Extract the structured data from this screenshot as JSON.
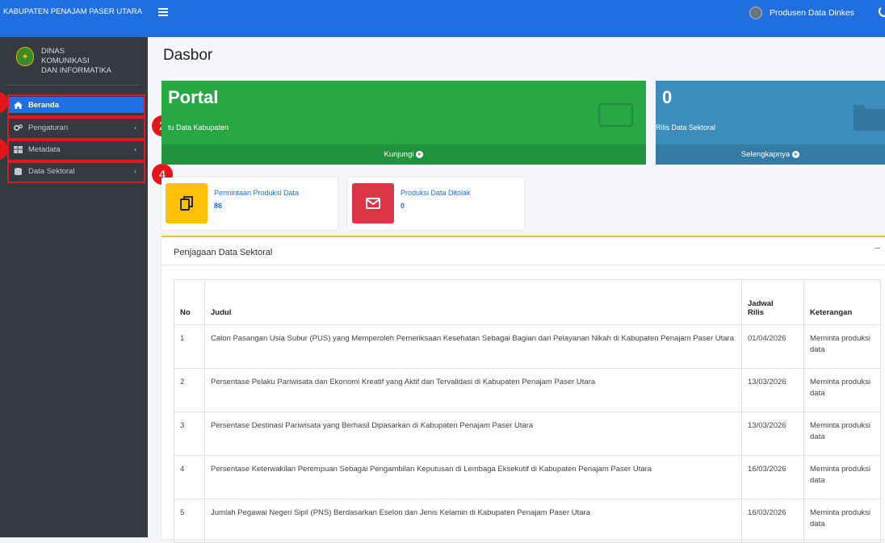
{
  "brand": {
    "title": "KABUPATEN PENAJAM PASER UTARA"
  },
  "navbar": {
    "user_name": "Produsen Data Dinkes"
  },
  "sidebar": {
    "org_name_line1": "DINAS KOMUNIKASI",
    "org_name_line2": "DAN INFORMATIKA",
    "items": [
      {
        "label": "Beranda",
        "icon": "home-icon",
        "active": true
      },
      {
        "label": "Pengaturan",
        "icon": "gears-icon"
      },
      {
        "label": "Metadata",
        "icon": "grid-icon"
      },
      {
        "label": "Data Sektoral",
        "icon": "database-icon"
      }
    ]
  },
  "annotations": {
    "badge2": "2",
    "badge4": "4"
  },
  "page_title": "Dasbor",
  "cards": {
    "portal": {
      "title": "Portal",
      "subtitle": "tu Data Kabupaten",
      "footer": "Kunjungi",
      "color": "#28a745"
    },
    "rilis": {
      "value": "0",
      "subtitle": "Rilis Data Sektoral",
      "footer": "Selengkapnya",
      "color": "#3c8dbc"
    }
  },
  "info_boxes": [
    {
      "label": "Permintaan Produksi Data",
      "value": "86",
      "icon": "copy-icon",
      "color": "#ffc107"
    },
    {
      "label": "Produksi Data Ditolak",
      "value": "0",
      "icon": "envelope-icon",
      "color": "#dc3545"
    }
  ],
  "panel": {
    "title": "Penjagaan Data Sektoral",
    "columns": {
      "no": "No",
      "judul": "Judul",
      "jadwal_1": "Jadwal",
      "jadwal_2": "Rilis",
      "ket": "Keterangan"
    },
    "rows": [
      {
        "no": "1",
        "judul": "Calon Pasangan Usia Subur (PUS) yang Memperoleh Pemeriksaan Kesehatan Sebagai Bagian dari Pelayanan Nikah di Kabupaten Penajam Paser Utara",
        "jadwal": "01/04/2026",
        "ket": "Meminta produksi data"
      },
      {
        "no": "2",
        "judul": "Persentase Pelaku Pariwisata dan Ekonomi Kreatif yang Aktif dan Tervalidasi di Kabupaten Penajam Paser Utara",
        "jadwal": "13/03/2026",
        "ket": "Meminta produksi data"
      },
      {
        "no": "3",
        "judul": "Persentase Destinasi Pariwisata yang Berhasil Dipasarkan di Kabupaten Penajam Paser Utara",
        "jadwal": "13/03/2026",
        "ket": "Meminta produksi data"
      },
      {
        "no": "4",
        "judul": "Persentase Keterwakilan Perempuan Sebagai Pengambilan Keputusan di Lembaga Eksekutif di Kabupaten Penajam Paser Utara",
        "jadwal": "16/03/2026",
        "ket": "Meminta produksi data"
      },
      {
        "no": "5",
        "judul": "Jumlah Pegawai Negeri Sipil (PNS) Berdasarkan Eselon dan Jenis Kelamin di Kabupaten Penajam Paser Utara",
        "jadwal": "16/03/2026",
        "ket": "Meminta produksi data"
      }
    ]
  }
}
